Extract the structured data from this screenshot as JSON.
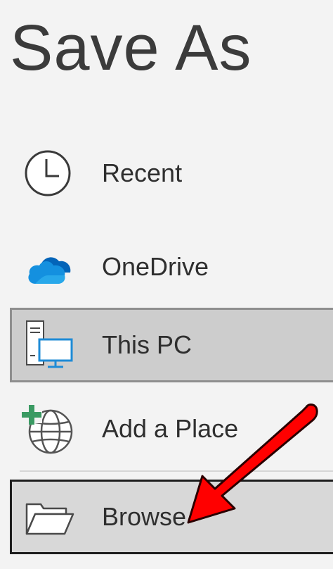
{
  "dialog": {
    "title": "Save As"
  },
  "locations": [
    {
      "id": "recent",
      "label": "Recent",
      "icon": "clock-icon"
    },
    {
      "id": "onedrive",
      "label": "OneDrive",
      "icon": "cloud-icon"
    },
    {
      "id": "thispc",
      "label": "This PC",
      "icon": "computer-icon",
      "selected": true
    },
    {
      "id": "addplace",
      "label": "Add a Place",
      "icon": "globe-add-icon"
    },
    {
      "id": "browse",
      "label": "Browse",
      "icon": "folder-open-icon",
      "highlighted": true
    }
  ],
  "colors": {
    "background": "#f3f3f3",
    "selected_fill": "#cdcdcd",
    "onedrive_blue": "#0a6cd4",
    "pc_blue": "#1e8bd6",
    "add_green": "#2e8b57",
    "annotation_arrow": "#ff0000"
  }
}
